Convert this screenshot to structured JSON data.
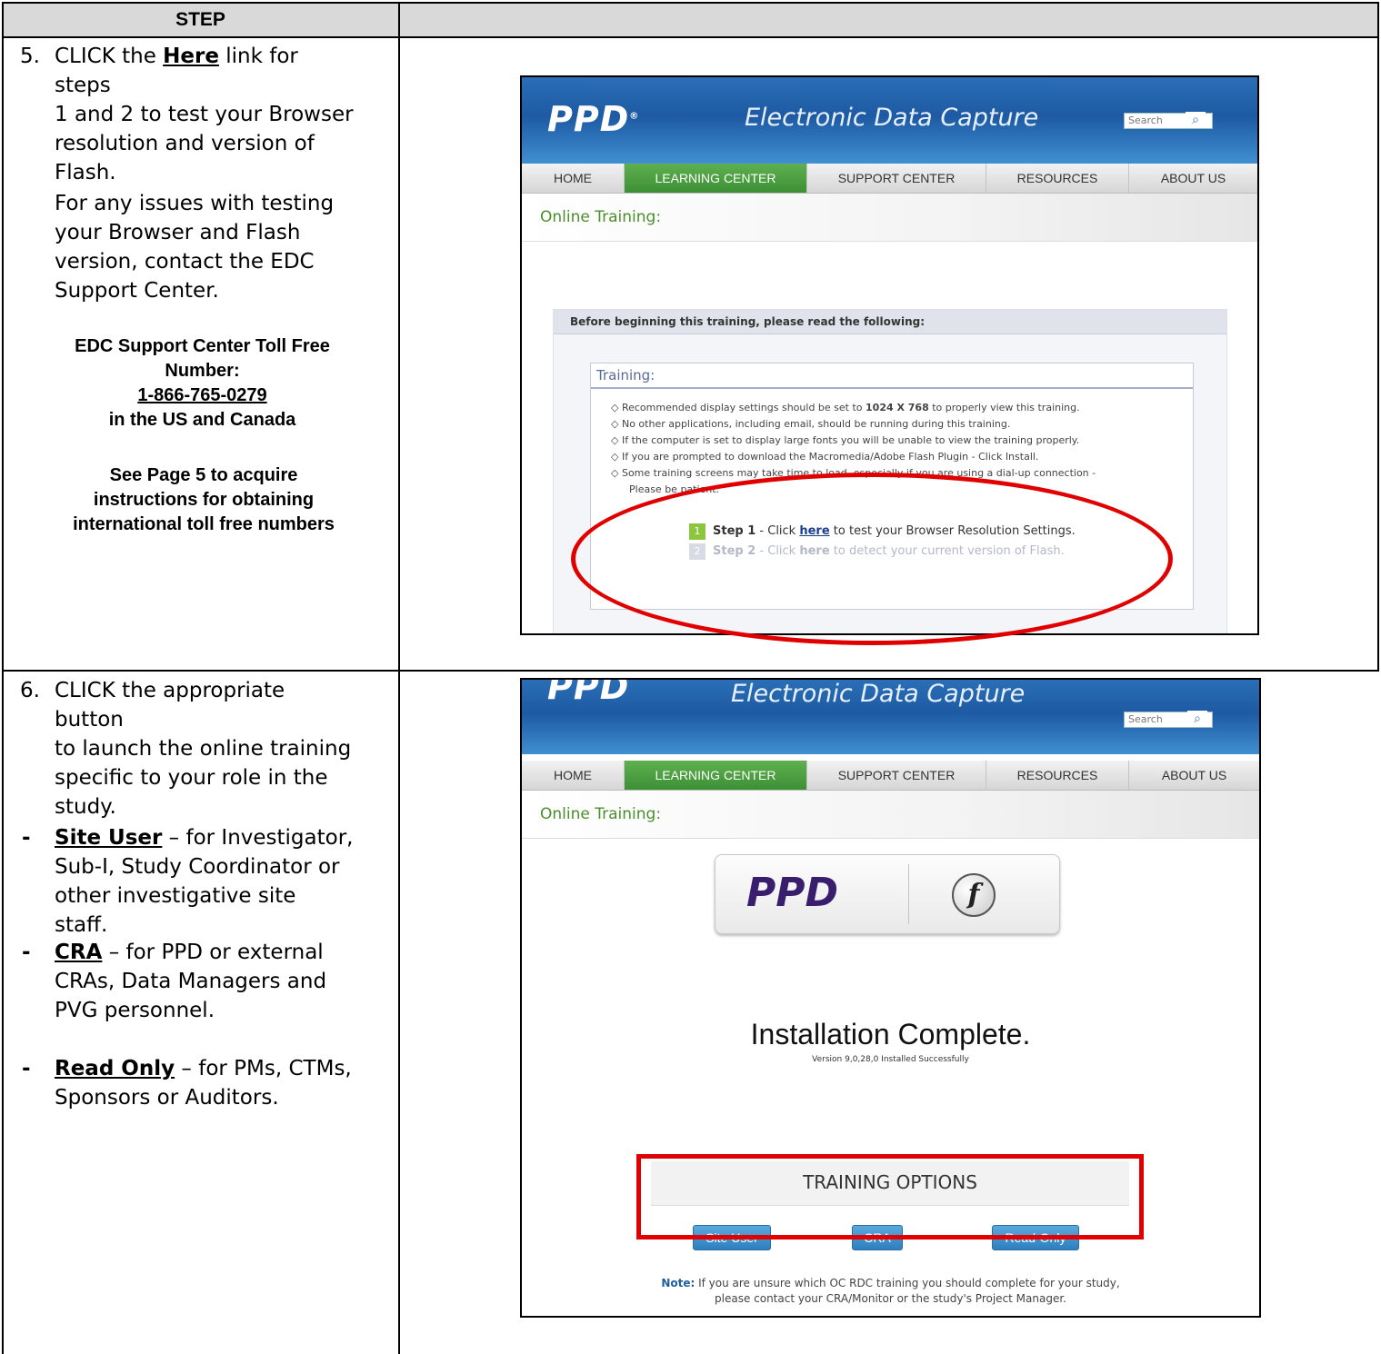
{
  "table": {
    "header_step": "STEP",
    "header_right": ""
  },
  "row5": {
    "num": "5.",
    "line1_pre": "CLICK the ",
    "line1_link": "Here",
    "line1_post": " link for steps",
    "line2": "1 and 2 to test your Browser",
    "line3": "resolution and version of",
    "line4": "Flash.",
    "issues1": "For any issues with testing",
    "issues2": "your Browser and Flash",
    "issues3": "version, contact the EDC",
    "issues4": "Support Center.",
    "toll1": "EDC Support Center Toll Free",
    "toll2": "Number:",
    "toll_number": "1-866-765-0279",
    "toll3": "in the US and Canada",
    "see1": "See Page 5 to acquire",
    "see2": "instructions for obtaining",
    "see3": "international toll free numbers"
  },
  "row6": {
    "num": "6.",
    "l1": "CLICK the appropriate button",
    "l2": "to launch the online training",
    "l3": "specific to your role in the",
    "l4": "study.",
    "dash": "-",
    "site_user": "Site User",
    "site_user_desc1": " – for Investigator,",
    "site_user_desc2": "Sub-I, Study Coordinator or",
    "site_user_desc3": "other investigative site staff.",
    "cra": "CRA",
    "cra_desc1": " – for PPD or external",
    "cra_desc2": "CRAs, Data Managers and",
    "cra_desc3": "PVG personnel.",
    "read_only": "Read Only",
    "read_only_desc1": " – for PMs, CTMs,",
    "read_only_desc2": "Sponsors or Auditors."
  },
  "site": {
    "logo": "PPD",
    "logo_mark": "®",
    "title": "Electronic Data Capture",
    "search_placeholder": "Search",
    "search_icon": "magnifier-icon",
    "nav": [
      "HOME",
      "LEARNING CENTER",
      "SUPPORT CENTER",
      "RESOURCES",
      "ABOUT US"
    ],
    "active_nav": "LEARNING CENTER",
    "online_training": "Online Training:"
  },
  "shot1": {
    "before": "Before beginning this training, please read the following:",
    "training": "Training:",
    "bullets": [
      "Recommended display settings should be set to ",
      "No other applications, including email, should be running during this training.",
      "If the computer is set to display large fonts you will be unable to view the training properly.",
      "If you are prompted to download the Macromedia/Adobe Flash Plugin - Click Install.",
      "Some training screens may take time to load, especially if you are using a dial-up connection -",
      "Please be patient."
    ],
    "resolution": "1024 X 768",
    "resolution_post": " to properly view this training.",
    "step1_num": "1",
    "step1_label": "Step 1",
    "step1_pre": " - Click ",
    "step1_link": "here",
    "step1_post": " to test your Browser Resolution Settings.",
    "step2_num": "2",
    "step2_label": "Step 2",
    "step2_pre": " - Click ",
    "step2_link": "here",
    "step2_post": " to detect your current version of Flash."
  },
  "shot2": {
    "flash_letter": "f",
    "installation": "Installation Complete.",
    "version": "Version 9,0,28,0 Installed Successfully",
    "training_options": "TRAINING OPTIONS",
    "buttons": [
      "Site User",
      "CRA",
      "Read-Only"
    ],
    "note_label": "Note:",
    "note1": " If you are unsure which OC RDC training you should complete for your study,",
    "note2": "please contact your CRA/Monitor or the study's Project Manager."
  },
  "colors": {
    "banner_blue": "#1d5aa3",
    "nav_green": "#3d8f36",
    "highlight_red": "#e00000",
    "online_training_green": "#4a8f2b"
  }
}
